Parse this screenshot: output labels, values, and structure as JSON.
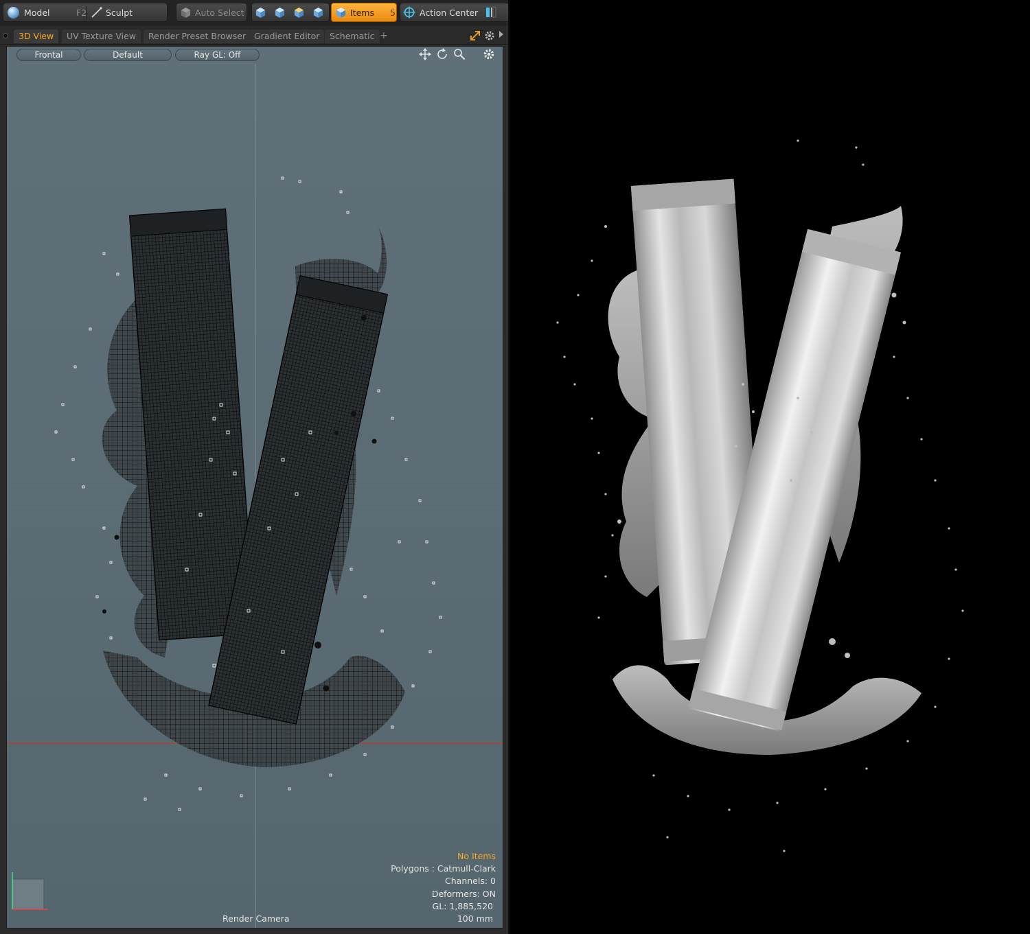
{
  "toolbar": {
    "model_label": "Model",
    "model_shortcut": "F2",
    "sculpt_label": "Sculpt",
    "auto_select_label": "Auto Select",
    "items_label": "Items",
    "items_shortcut": "5",
    "action_center_label": "Action Center"
  },
  "tabs": [
    {
      "label": "3D View",
      "active": true
    },
    {
      "label": "UV Texture View",
      "active": false
    },
    {
      "label": "Render Preset Browser",
      "active": false
    },
    {
      "label": "Gradient Editor",
      "active": false
    },
    {
      "label": "Schematic",
      "active": false
    }
  ],
  "tab_add": "+",
  "viewport_controls": {
    "view_label": "Frontal",
    "shading_label": "Default",
    "raygl_label": "Ray GL: Off"
  },
  "hud": {
    "selection": "No Items",
    "polygons": "Polygons : Catmull-Clark",
    "channels": "Channels: 0",
    "deformers": "Deformers: ON",
    "gl": "GL: 1,885,520",
    "scale": "100 mm",
    "camera": "Render Camera"
  },
  "colors": {
    "accent": "#f5a623",
    "viewport_bg": "#5b6b73",
    "render_bg": "#000000",
    "wire": "#151515"
  },
  "icons": {
    "model": "sphere-icon",
    "sculpt": "brush-icon",
    "move": "move-arrows-icon",
    "rotate": "rotate-icon",
    "zoom": "magnifier-icon",
    "settings": "gear-icon"
  }
}
